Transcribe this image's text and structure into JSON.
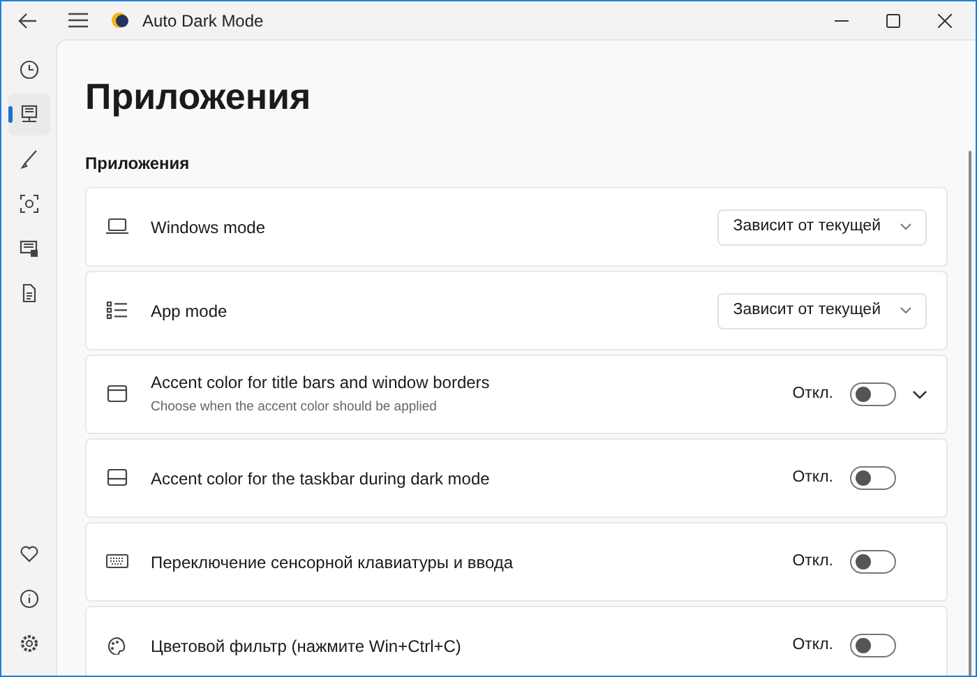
{
  "window": {
    "title": "Auto Dark Mode"
  },
  "nav": {
    "top": [
      {
        "selected": false
      },
      {
        "selected": true
      },
      {
        "selected": false
      },
      {
        "selected": false
      },
      {
        "selected": false
      },
      {
        "selected": false
      }
    ],
    "bottom": [
      {
        "selected": false
      },
      {
        "selected": false
      },
      {
        "selected": false
      }
    ]
  },
  "page_title": "Приложения",
  "section_title": "Приложения",
  "settings": [
    {
      "kind": "dropdown",
      "label": "Windows mode",
      "value": "Зависит от текущей"
    },
    {
      "kind": "dropdown",
      "label": "App mode",
      "value": "Зависит от текущей"
    },
    {
      "kind": "toggle",
      "label": "Accent color for title bars and window borders",
      "description": "Choose when the accent color should be applied",
      "state_label": "Откл.",
      "on": false,
      "expandable": true
    },
    {
      "kind": "toggle",
      "label": "Accent color for the taskbar during dark mode",
      "state_label": "Откл.",
      "on": false
    },
    {
      "kind": "toggle",
      "label": "Переключение сенсорной клавиатуры и ввода",
      "state_label": "Откл.",
      "on": false
    },
    {
      "kind": "toggle",
      "label": "Цветовой фильтр (нажмите Win+Ctrl+C)",
      "state_label": "Откл.",
      "on": false
    }
  ]
}
